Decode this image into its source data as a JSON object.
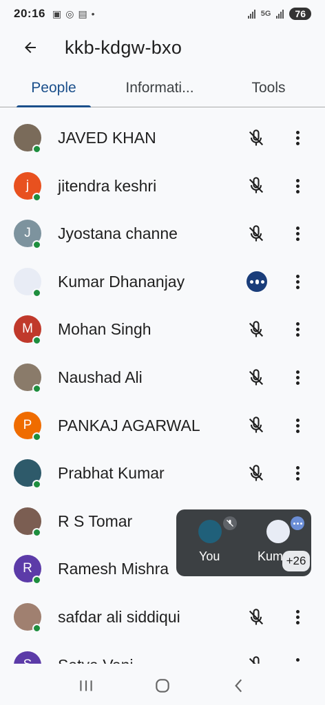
{
  "status_bar": {
    "time": "20:16",
    "network": "5G",
    "battery": "76"
  },
  "app_bar": {
    "title": "kkb-kdgw-bxo"
  },
  "tabs": [
    {
      "label": "People",
      "active": true
    },
    {
      "label": "Informati...",
      "active": false
    },
    {
      "label": "Tools",
      "active": false
    }
  ],
  "participants": [
    {
      "name": "JAVED KHAN",
      "initial": "",
      "avatar_color": "#7a6b5a",
      "has_photo": true,
      "state": "muted"
    },
    {
      "name": "jitendra keshri",
      "initial": "j",
      "avatar_color": "#e8511f",
      "has_photo": false,
      "state": "muted"
    },
    {
      "name": "Jyostana channe",
      "initial": "J",
      "avatar_color": "#7d939e",
      "has_photo": false,
      "state": "muted"
    },
    {
      "name": "Kumar Dhananjay",
      "initial": "",
      "avatar_color": "#e8ecf5",
      "has_photo": true,
      "state": "speaking"
    },
    {
      "name": "Mohan Singh",
      "initial": "M",
      "avatar_color": "#c0392b",
      "has_photo": false,
      "state": "muted"
    },
    {
      "name": "Naushad Ali",
      "initial": "",
      "avatar_color": "#8a7b6a",
      "has_photo": true,
      "state": "muted"
    },
    {
      "name": "PANKAJ AGARWAL",
      "initial": "P",
      "avatar_color": "#ef6c00",
      "has_photo": false,
      "state": "muted"
    },
    {
      "name": "Prabhat Kumar",
      "initial": "",
      "avatar_color": "#2e5a6a",
      "has_photo": true,
      "state": "muted"
    },
    {
      "name": "R S Tomar",
      "initial": "",
      "avatar_color": "#7b5e52",
      "has_photo": true,
      "state": "covered"
    },
    {
      "name": "Ramesh Mishra",
      "initial": "R",
      "avatar_color": "#5c3ba8",
      "has_photo": false,
      "state": "covered"
    },
    {
      "name": "safdar ali siddiqui",
      "initial": "",
      "avatar_color": "#a08070",
      "has_photo": true,
      "state": "muted"
    },
    {
      "name": "Satya Vani",
      "initial": "S",
      "avatar_color": "#5c3ba8",
      "has_photo": false,
      "state": "muted"
    }
  ],
  "pip": {
    "self_label": "You",
    "speaker_label": "Kum",
    "more_count": "+26"
  },
  "colors": {
    "accent": "#1a4f8b",
    "presence": "#1e8e3e",
    "speaking": "#1a3d7a",
    "pip_bg": "#3c4043"
  }
}
